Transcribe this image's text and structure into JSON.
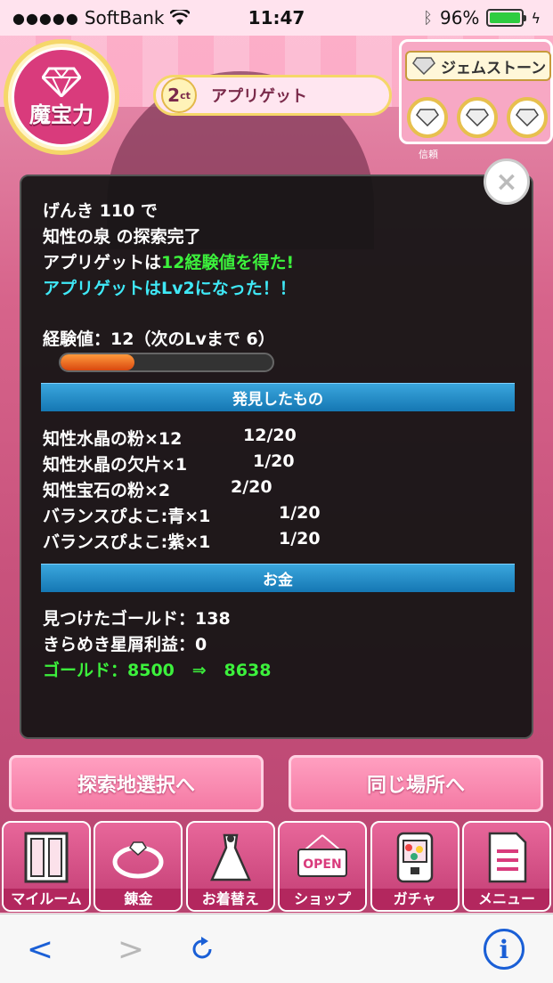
{
  "status_bar": {
    "carrier": "SoftBank",
    "time": "11:47",
    "battery": "96%"
  },
  "hud": {
    "mahouryoku_label": "魔宝力",
    "level": "2",
    "level_unit": "ct",
    "app_name": "アプリゲット",
    "gemstone_title": "ジェムストーン",
    "trust_label": "信頼"
  },
  "dialog": {
    "close_label": "×",
    "line1": "げんき 110 で",
    "line2": "知性の泉 の探索完了",
    "line3_prefix": "アプリゲットは",
    "line3_highlight": "12経験値を得た!",
    "line4": "アプリゲットはLv2になった！！",
    "exp_text": "経験値：12（次のLvまで 6）",
    "exp_progress": 0.35,
    "found_header": "発見したもの",
    "found_items": [
      {
        "name": "知性水晶の粉×12",
        "count": "12/20"
      },
      {
        "name": "知性水晶の欠片×1",
        "count": "1/20"
      },
      {
        "name": "知性宝石の粉×2",
        "count": "2/20"
      },
      {
        "name": "バランスぴよこ:青×1",
        "count": "1/20"
      },
      {
        "name": "バランスぴよこ:紫×1",
        "count": "1/20"
      }
    ],
    "money_header": "お金",
    "gold_found": "見つけたゴールド：138",
    "kirameki": "きらめき星屑利益：0",
    "gold_change_label": "ゴールド：8500",
    "gold_arrow": "⇒",
    "gold_new": "8638"
  },
  "actions": {
    "select_place": "探索地選択へ",
    "same_place": "同じ場所へ"
  },
  "nav": [
    {
      "label": "マイルーム",
      "icon": "room-icon"
    },
    {
      "label": "錬金",
      "icon": "ring-icon"
    },
    {
      "label": "お着替え",
      "icon": "dress-icon"
    },
    {
      "label": "ショップ",
      "icon": "shop-icon",
      "sign": "OPEN"
    },
    {
      "label": "ガチャ",
      "icon": "gacha-icon"
    },
    {
      "label": "メニュー",
      "icon": "menu-doc-icon"
    }
  ],
  "colors": {
    "accent_pink": "#d93b7c",
    "exp_green": "#3cf13c",
    "level_cyan": "#3fe8f6",
    "ios_blue": "#1a5fd6"
  }
}
